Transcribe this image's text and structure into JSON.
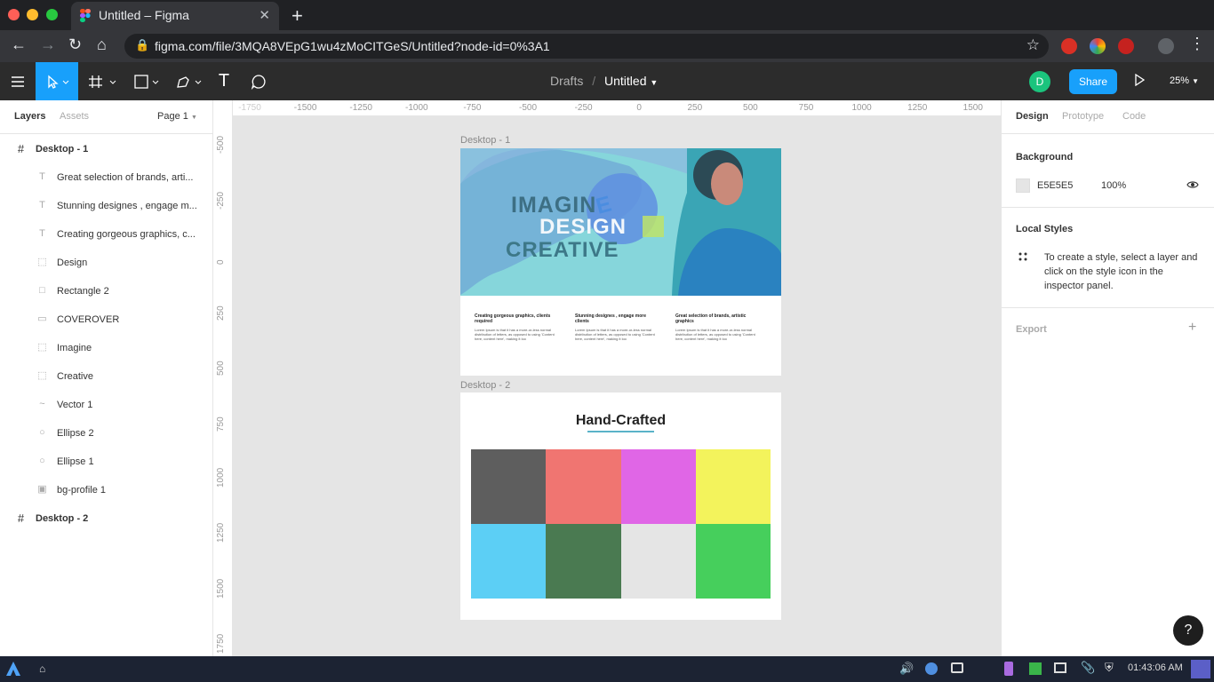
{
  "browser": {
    "tab_title": "Untitled – Figma",
    "url": "figma.com/file/3MQA8VEpG1wu4zMoCITGeS/Untitled?node-id=0%3A1",
    "new_tab": "+",
    "close": "✕"
  },
  "toolbar": {
    "breadcrumb_parent": "Drafts",
    "breadcrumb_sep": "/",
    "file_name": "Untitled",
    "avatar_letter": "D",
    "share_label": "Share",
    "zoom": "25%"
  },
  "left_panel": {
    "tabs": [
      "Layers",
      "Assets"
    ],
    "page": "Page 1",
    "layers": [
      {
        "name": "Desktop - 1",
        "type": "frame"
      },
      {
        "name": "Great selection of brands, arti...",
        "type": "text"
      },
      {
        "name": "Stunning designes , engage m...",
        "type": "text"
      },
      {
        "name": "Creating gorgeous graphics, c...",
        "type": "text"
      },
      {
        "name": "Design",
        "type": "group"
      },
      {
        "name": "Rectangle 2",
        "type": "rect"
      },
      {
        "name": "COVEROVER",
        "type": "rect-thin"
      },
      {
        "name": "Imagine",
        "type": "group"
      },
      {
        "name": "Creative",
        "type": "group"
      },
      {
        "name": "Vector 1",
        "type": "vector"
      },
      {
        "name": "Ellipse 2",
        "type": "ellipse"
      },
      {
        "name": "Ellipse 1",
        "type": "ellipse"
      },
      {
        "name": "bg-profile 1",
        "type": "image"
      },
      {
        "name": "Desktop - 2",
        "type": "frame"
      }
    ]
  },
  "right_panel": {
    "tabs": [
      "Design",
      "Prototype",
      "Code"
    ],
    "background_label": "Background",
    "bg_hex": "E5E5E5",
    "bg_opacity": "100%",
    "local_styles_label": "Local Styles",
    "local_styles_hint": "To create a style, select a layer and click on the style icon in the inspector panel.",
    "export_label": "Export",
    "export_add": "+"
  },
  "canvas": {
    "top_ruler": [
      "-1750",
      "-1500",
      "-1250",
      "-1000",
      "-750",
      "-500",
      "-250",
      "0",
      "250",
      "500",
      "750",
      "1000",
      "1250",
      "1500"
    ],
    "left_ruler": [
      "-500",
      "-250",
      "0",
      "250",
      "500",
      "750",
      "1000",
      "1250",
      "1500",
      "1750"
    ],
    "frame1": {
      "label": "Desktop - 1",
      "hero_line1": "IMAGIN",
      "hero_e": "E",
      "hero_line2": "DESIGN",
      "hero_line3": "CREATIVE",
      "columns": [
        {
          "title": "Creating gorgeous graphics, clients required",
          "body": "Lorem Ipsum is that it has a more-or-less normal distribution of letters, as opposed to using 'Content here, content here', making it loo"
        },
        {
          "title": "Stunning designes , engage more clients",
          "body": "Lorem Ipsum is that it has a more-or-less normal distribution of letters, as opposed to using 'Content here, content here', making it loo"
        },
        {
          "title": "Great selection of brands, artistic graphics",
          "body": "Lorem Ipsum is that it has a more-or-less normal distribution of letters, as opposed to using 'Content here, content here', making it loo"
        }
      ]
    },
    "frame2": {
      "label": "Desktop - 2",
      "heading": "Hand-Crafted",
      "swatches": [
        "#5e5e5e",
        "#f07571",
        "#e066e6",
        "#f3f35c",
        "#5ccff5",
        "#4a7a51",
        "#e5e5e5",
        "#46cf5c"
      ]
    }
  },
  "help": "?",
  "taskbar": {
    "time": "01:43:06 AM"
  },
  "colors": {
    "accent": "#18a0fb",
    "dark_bar": "#2c2c2c",
    "avatar": "#1bc47d"
  }
}
